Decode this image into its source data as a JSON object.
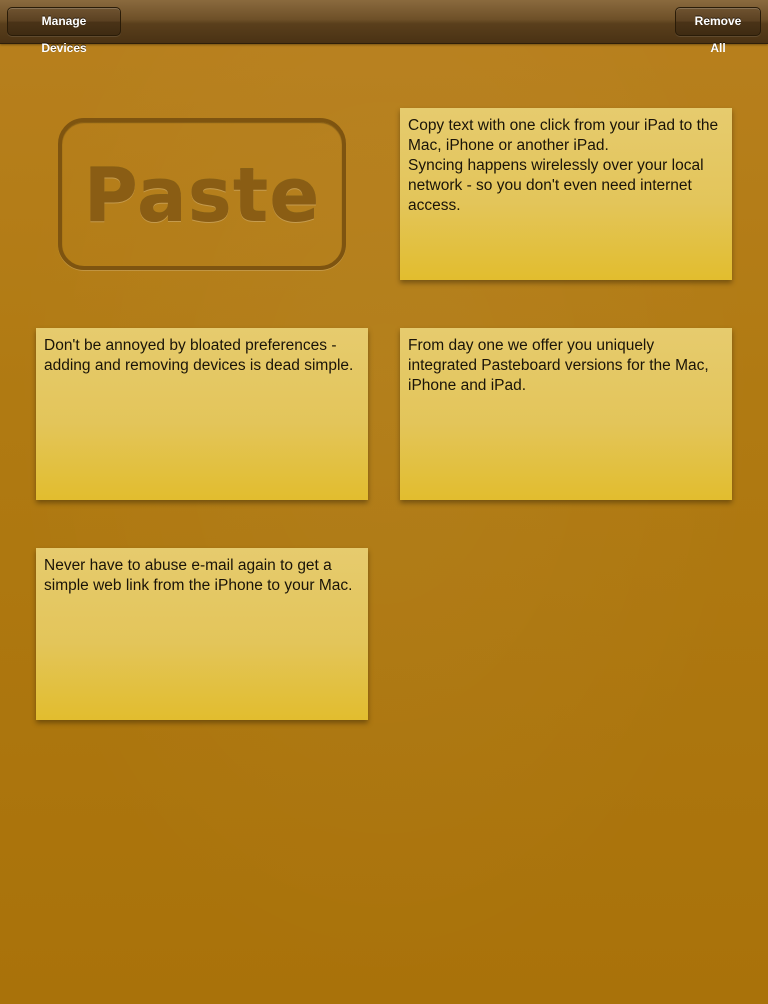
{
  "toolbar": {
    "manage_devices_label": "Manage Devices",
    "remove_all_label": "Remove All"
  },
  "logo": {
    "text": "Paste"
  },
  "notes": [
    {
      "text": "Copy text with one click from your iPad to the Mac, iPhone or another iPad.\nSyncing happens wirelessly over your local network - so you don't even need internet access."
    },
    {
      "text": "Don't be annoyed by bloated preferences - adding and removing devices is dead simple."
    },
    {
      "text": "From day one we offer you uniquely integrated Pasteboard versions for the Mac, iPhone and iPad."
    },
    {
      "text": "Never have to abuse e-mail again to get a simple web link from the iPhone to your Mac."
    }
  ],
  "colors": {
    "background": "#b07a12",
    "toolbar": "#5a3f1c",
    "note": "#e3c55a",
    "logo": "#8a5d14"
  }
}
